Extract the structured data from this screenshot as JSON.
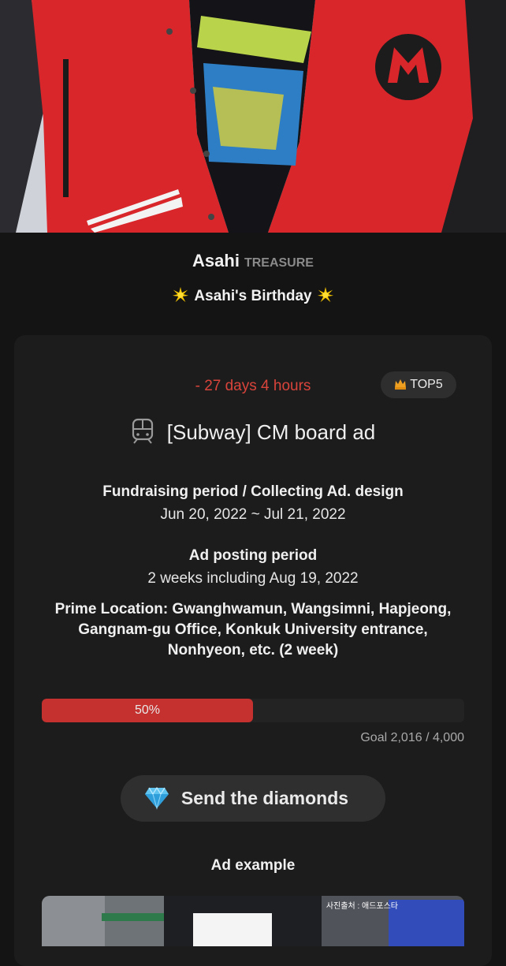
{
  "artist": {
    "name": "Asahi",
    "group": "TREASURE"
  },
  "event": {
    "title": "Asahi's Birthday"
  },
  "ad": {
    "countdown": "- 27 days 4 hours",
    "rank_badge": "TOP5",
    "title": "[Subway] CM board ad",
    "fundraising_label": "Fundraising period / Collecting Ad. design",
    "fundraising_value": "Jun 20, 2022 ~ Jul 21, 2022",
    "posting_label": "Ad posting period",
    "posting_value": "2 weeks including Aug 19, 2022",
    "location_line1": "Prime Location: Gwanghwamun, Wangsimni, Hapjeong,",
    "location_line2": "Gangnam-gu Office, Konkuk University entrance,",
    "location_line3": "Nonhyeon, etc. (2 week)"
  },
  "progress": {
    "percent_label": "50%",
    "fraction": 0.5,
    "goal": "Goal 2,016 / 4,000"
  },
  "send_button": {
    "label": "Send the diamonds"
  },
  "example": {
    "heading": "Ad example",
    "photo_credit": "사진출처 : 애드포스타"
  },
  "colors": {
    "accent_red": "#c4312e",
    "countdown_red": "#d9443b",
    "background": "#141414"
  },
  "icons": {
    "sparkle": "sparkle-icon",
    "crown": "crown-icon",
    "train": "train-icon",
    "gem": "diamond-icon"
  }
}
